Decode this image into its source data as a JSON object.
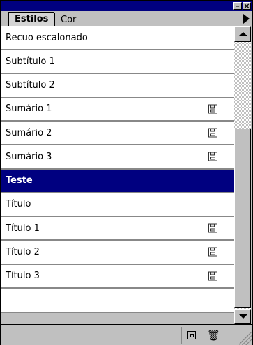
{
  "window": {
    "minimize_glyph": "–",
    "close_glyph": "×"
  },
  "tabs": [
    {
      "label": "Estilos",
      "active": true
    },
    {
      "label": "Cor",
      "active": false
    }
  ],
  "styles": [
    {
      "label": "Recuo escalonado",
      "saved": false,
      "selected": false
    },
    {
      "label": "Subtítulo 1",
      "saved": false,
      "selected": false
    },
    {
      "label": "Subtítulo 2",
      "saved": false,
      "selected": false
    },
    {
      "label": "Sumário 1",
      "saved": true,
      "selected": false
    },
    {
      "label": "Sumário 2",
      "saved": true,
      "selected": false
    },
    {
      "label": "Sumário 3",
      "saved": true,
      "selected": false
    },
    {
      "label": "Teste",
      "saved": false,
      "selected": true
    },
    {
      "label": "Título",
      "saved": false,
      "selected": false
    },
    {
      "label": "Título 1",
      "saved": true,
      "selected": false
    },
    {
      "label": "Título 2",
      "saved": true,
      "selected": false
    },
    {
      "label": "Título 3",
      "saved": true,
      "selected": false
    }
  ],
  "footer": {
    "trash_glyph": "🗑"
  },
  "colors": {
    "selection": "#000080",
    "face": "#c0c0c0"
  },
  "icons": [
    "minimize-icon",
    "close-icon",
    "palette-menu-arrow-icon",
    "save-icon",
    "new-style-icon",
    "trash-icon",
    "scroll-up-arrow-icon",
    "scroll-down-arrow-icon",
    "resize-grip-icon"
  ]
}
